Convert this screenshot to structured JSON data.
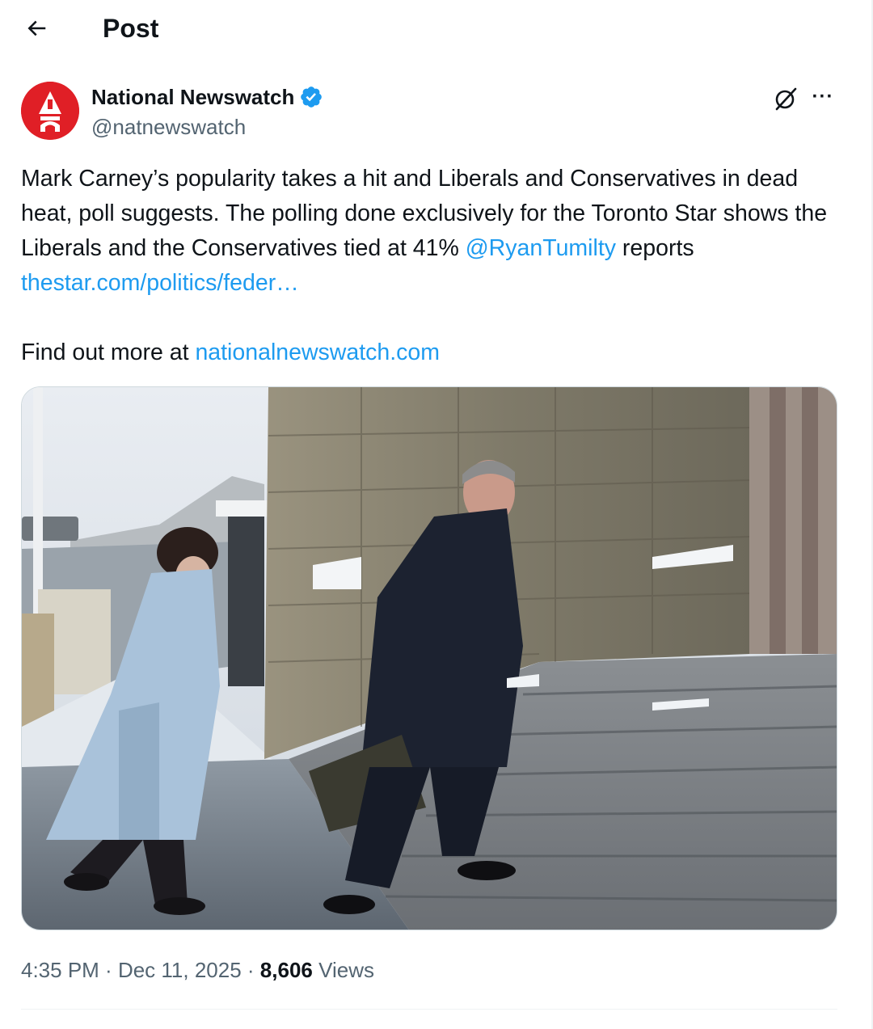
{
  "header": {
    "title": "Post",
    "back_icon": "arrow-left-icon"
  },
  "author": {
    "display_name": "National Newswatch",
    "handle": "@natnewswatch",
    "verified": true,
    "avatar_color": "#e01f26",
    "verified_color": "#1d9bf0"
  },
  "actions": {
    "grok_icon": "grok-icon",
    "more_label": "···"
  },
  "post": {
    "text_main": "Mark Carney’s popularity takes a hit and Liberals and Conservatives in dead heat, poll suggests. The polling done exclusively for the Toronto Star shows the Liberals and the Conservatives tied at 41% ",
    "mention": "@RyanTumilty",
    "text_reports": " reports ",
    "link_1": "thestar.com/politics/feder…",
    "text_find_out": "Find out more at ",
    "link_2": "nationalnewswatch.com",
    "link_color": "#1d9bf0"
  },
  "meta": {
    "time": "4:35 PM",
    "sep1": " · ",
    "date": "Dec 11, 2025",
    "sep2": " · ",
    "views_count": "8,606",
    "views_label": " Views"
  }
}
